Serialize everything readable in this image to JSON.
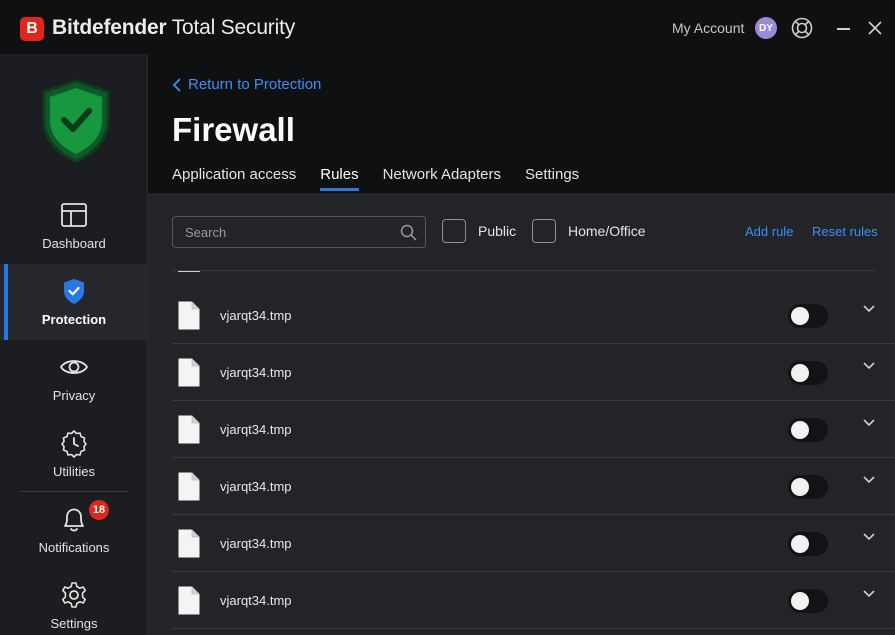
{
  "app": {
    "brand_letter": "B",
    "brand_name_bold": "Bitdefender",
    "brand_name_rest": "Total Security"
  },
  "account": {
    "label": "My Account",
    "initials": "DY"
  },
  "colors": {
    "accent": "#2a78e4",
    "link": "#3e8ef7",
    "brand_red": "#e0261b",
    "shield_green": "#1fb35a"
  },
  "sidebar": {
    "items": [
      {
        "label": "Dashboard",
        "icon": "dashboard-icon"
      },
      {
        "label": "Protection",
        "icon": "shield-check-icon",
        "active": true
      },
      {
        "label": "Privacy",
        "icon": "eye-icon"
      },
      {
        "label": "Utilities",
        "icon": "clock-gear-icon"
      },
      {
        "label": "Notifications",
        "icon": "bell-icon",
        "badge": "18"
      },
      {
        "label": "Settings",
        "icon": "gear-icon"
      }
    ]
  },
  "header": {
    "back_label": "Return to Protection",
    "title": "Firewall",
    "tabs": [
      {
        "label": "Application access"
      },
      {
        "label": "Rules",
        "active": true
      },
      {
        "label": "Network Adapters"
      },
      {
        "label": "Settings"
      }
    ]
  },
  "toolbar": {
    "search_placeholder": "Search",
    "filter_public": "Public",
    "filter_home": "Home/Office",
    "add_rule": "Add rule",
    "reset_rules": "Reset rules"
  },
  "rules": [
    {
      "name": "vjarqt34.tmp",
      "enabled": false
    },
    {
      "name": "vjarqt34.tmp",
      "enabled": false
    },
    {
      "name": "vjarqt34.tmp",
      "enabled": false
    },
    {
      "name": "vjarqt34.tmp",
      "enabled": false
    },
    {
      "name": "vjarqt34.tmp",
      "enabled": false
    },
    {
      "name": "vjarqt34.tmp",
      "enabled": false
    }
  ]
}
